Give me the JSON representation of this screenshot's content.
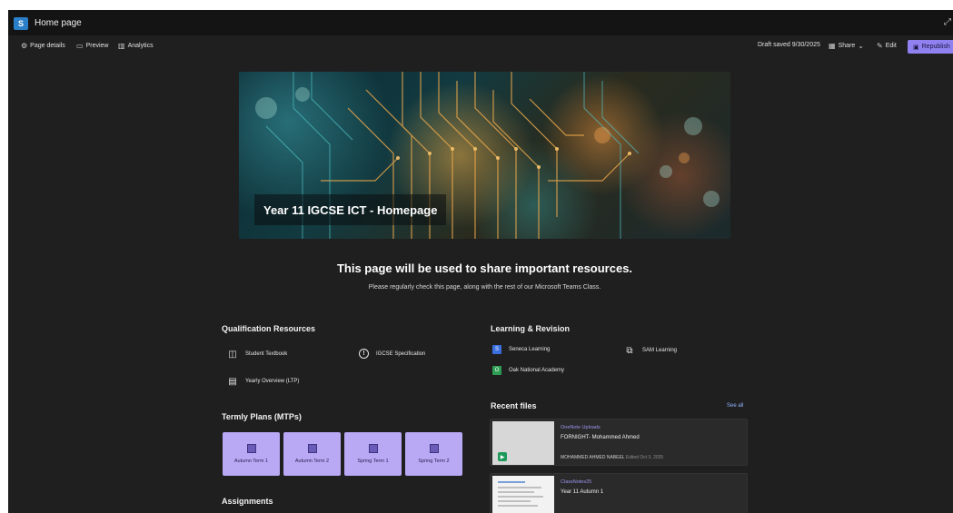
{
  "window": {
    "title": "Home page",
    "app_logo_text": "S"
  },
  "cmdbar": {
    "page_details": "Page details",
    "preview": "Preview",
    "analytics": "Analytics",
    "draft_status": "Draft saved 9/30/2025",
    "share": "Share",
    "edit": "Edit",
    "republish": "Republish"
  },
  "hero": {
    "title": "Year 11 IGCSE ICT - Homepage"
  },
  "intro": {
    "headline": "This page will be used to share important resources.",
    "subline": "Please regularly check this page, along with the rest of our Microsoft Teams Class."
  },
  "qualification": {
    "heading": "Qualification Resources",
    "items": [
      {
        "label": "Student Textbook",
        "icon": "book-icon"
      },
      {
        "label": "IGCSE Specification",
        "icon": "info-icon"
      },
      {
        "label": "Yearly Overview (LTP)",
        "icon": "calendar-icon"
      }
    ]
  },
  "learning": {
    "heading": "Learning & Revision",
    "items": [
      {
        "label": "Seneca Learning",
        "icon": "seneca-icon",
        "color": "#3b6fe0"
      },
      {
        "label": "SAM Learning",
        "icon": "external-link-icon"
      },
      {
        "label": "Oak National Academy",
        "icon": "oak-icon",
        "color": "#2e9e55"
      }
    ]
  },
  "termly": {
    "heading": "Termly Plans (MTPs)",
    "items": [
      "Autumn Term 1",
      "Autumn Term 2",
      "Spring Term 1",
      "Spring Term 2"
    ]
  },
  "assignments": {
    "heading": "Assignments"
  },
  "recent_files": {
    "heading": "Recent files",
    "see_all": "See all",
    "files": [
      {
        "app": "OneNote Uploads",
        "name": "FORNIGHT- Mohammed Ahmed",
        "author": "MOHAMMED AHMED NABEEL",
        "edited": "Edited Oct 3, 2025"
      },
      {
        "app": "ClassNotes25",
        "name": "Year 11 Autumn 1"
      }
    ]
  }
}
